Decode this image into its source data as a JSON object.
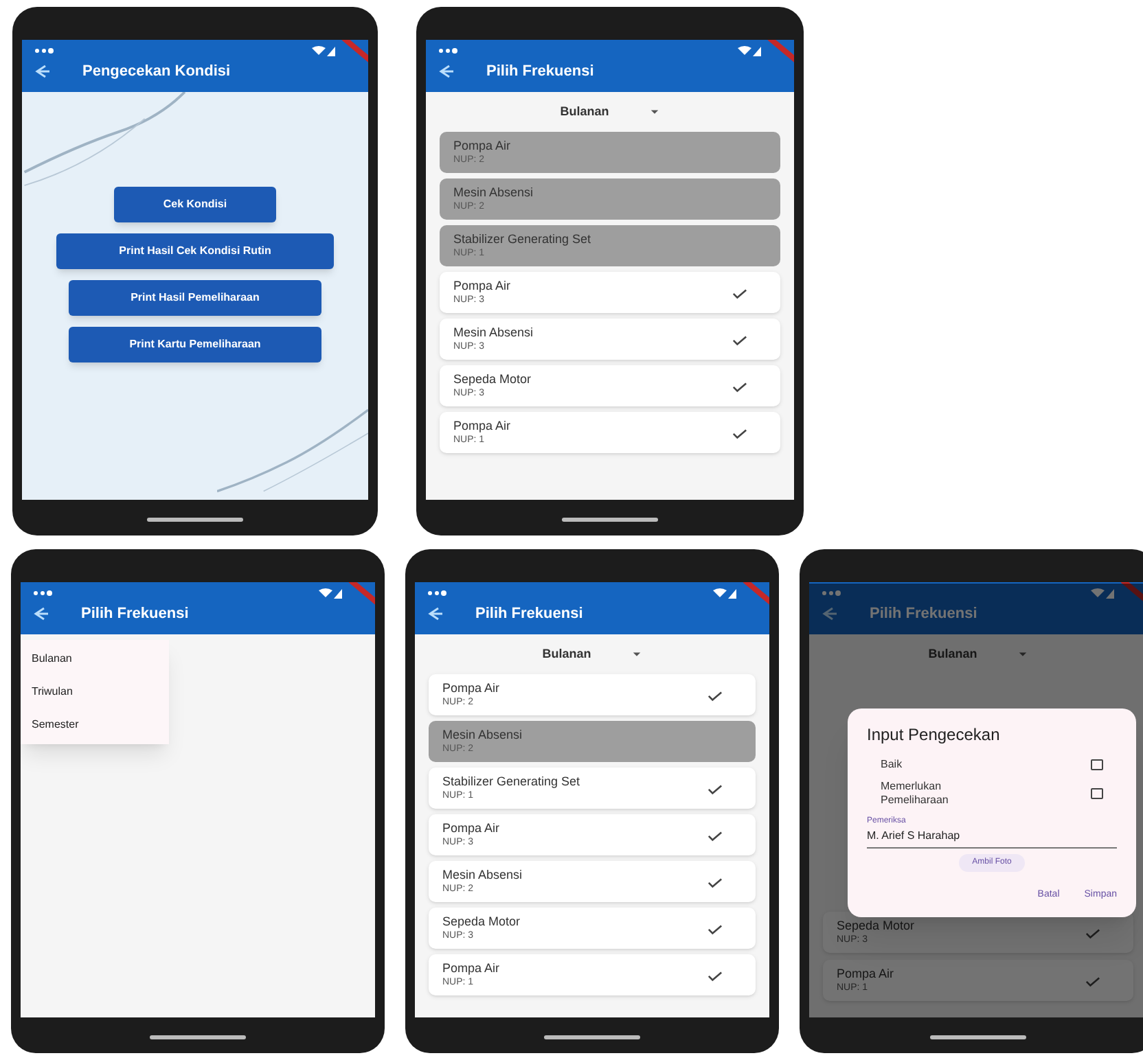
{
  "screens": [
    {
      "kind": "menu",
      "title": "Pengecekan Kondisi",
      "buttons": [
        "Cek Kondisi",
        "Print Hasil Cek Kondisi Rutin",
        "Print Hasil Pemeliharaan",
        "Print Kartu Pemeliharaan"
      ]
    },
    {
      "kind": "list",
      "title": "Pilih Frekuensi",
      "frequency": "Bulanan",
      "items": [
        {
          "name": "Pompa Air",
          "nup": "NUP: 2",
          "checked": false
        },
        {
          "name": "Mesin Absensi",
          "nup": "NUP: 2",
          "checked": false
        },
        {
          "name": "Stabilizer Generating Set",
          "nup": "NUP: 1",
          "checked": false
        },
        {
          "name": "Pompa Air",
          "nup": "NUP: 3",
          "checked": true
        },
        {
          "name": "Mesin Absensi",
          "nup": "NUP: 3",
          "checked": true
        },
        {
          "name": "Sepeda Motor",
          "nup": "NUP: 3",
          "checked": true
        },
        {
          "name": "Pompa Air",
          "nup": "NUP: 1",
          "checked": true
        }
      ]
    },
    {
      "kind": "dropdown",
      "title": "Pilih Frekuensi",
      "options": [
        "Bulanan",
        "Triwulan",
        "Semester"
      ]
    },
    {
      "kind": "list",
      "title": "Pilih Frekuensi",
      "frequency": "Bulanan",
      "items": [
        {
          "name": "Pompa Air",
          "nup": "NUP: 2",
          "checked": true
        },
        {
          "name": "Mesin Absensi",
          "nup": "NUP: 2",
          "checked": false
        },
        {
          "name": "Stabilizer Generating Set",
          "nup": "NUP: 1",
          "checked": true
        },
        {
          "name": "Pompa Air",
          "nup": "NUP: 3",
          "checked": true
        },
        {
          "name": "Mesin Absensi",
          "nup": "NUP: 2",
          "checked": true
        },
        {
          "name": "Sepeda Motor",
          "nup": "NUP: 3",
          "checked": true
        },
        {
          "name": "Pompa Air",
          "nup": "NUP: 1",
          "checked": true
        }
      ]
    },
    {
      "kind": "dialog",
      "title": "Pilih Frekuensi",
      "frequency": "Bulanan",
      "items": [
        {
          "name": "Sepeda Motor",
          "nup": "NUP: 3",
          "checked": true
        },
        {
          "name": "Pompa Air",
          "nup": "NUP: 1",
          "checked": true
        }
      ],
      "dialog": {
        "title": "Input Pengecekan",
        "options": [
          {
            "label": "Baik",
            "checked": false
          },
          {
            "label": "Memerlukan Pemeliharaan",
            "checked": false
          }
        ],
        "field": {
          "label": "Pemeriksa",
          "value": "M. Arief S Harahap"
        },
        "photo_button": "Ambil Foto",
        "actions": [
          "Batal",
          "Simpan"
        ]
      }
    }
  ]
}
